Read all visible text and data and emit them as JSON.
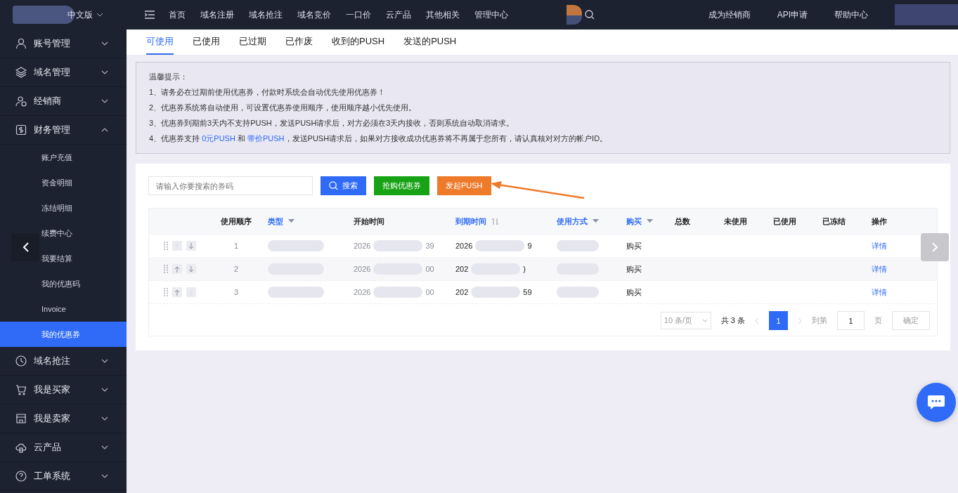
{
  "topbar": {
    "language": "中文版",
    "nav": [
      "首页",
      "域名注册",
      "域名抢注",
      "域名竞价",
      "一口价",
      "云产品",
      "其他相关",
      "管理中心"
    ],
    "right_links": [
      "成为经销商",
      "API申请",
      "帮助中心"
    ]
  },
  "sidebar": {
    "items": [
      {
        "label": "账号管理",
        "kind": "user",
        "expanded": false
      },
      {
        "label": "域名管理",
        "kind": "layers",
        "expanded": false
      },
      {
        "label": "经销商",
        "kind": "dealer",
        "expanded": false
      },
      {
        "label": "财务管理",
        "kind": "wallet",
        "expanded": true,
        "children": [
          {
            "label": "账户充值",
            "selected": false
          },
          {
            "label": "资金明细",
            "selected": false
          },
          {
            "label": "冻结明细",
            "selected": false
          },
          {
            "label": "续费中心",
            "selected": false
          },
          {
            "label": "我要结算",
            "selected": false
          },
          {
            "label": "我的优惠码",
            "selected": false
          },
          {
            "label": "Invoice",
            "selected": false
          },
          {
            "label": "我的优惠券",
            "selected": true
          }
        ]
      },
      {
        "label": "域名抢注",
        "kind": "clock",
        "expanded": false
      },
      {
        "label": "我是买家",
        "kind": "cart",
        "expanded": false
      },
      {
        "label": "我是卖家",
        "kind": "store",
        "expanded": false
      },
      {
        "label": "云产品",
        "kind": "cloud",
        "expanded": false
      },
      {
        "label": "工单系统",
        "kind": "help",
        "expanded": false
      }
    ]
  },
  "tabs": [
    {
      "label": "可使用",
      "selected": true
    },
    {
      "label": "已使用",
      "selected": false
    },
    {
      "label": "已过期",
      "selected": false
    },
    {
      "label": "已作废",
      "selected": false
    },
    {
      "label": "收到的PUSH",
      "selected": false
    },
    {
      "label": "发送的PUSH",
      "selected": false
    }
  ],
  "notice": {
    "title": "温馨提示：",
    "lines": [
      "1、请务必在过期前使用优惠券，付款时系统会自动优先使用优惠券！",
      "2、优惠券系统将自动使用，可设置优惠券使用顺序，使用顺序越小优先使用。",
      "3、优惠券到期前3天内不支持PUSH，发送PUSH请求后，对方必须在3天内接收，否则系统自动取消请求。"
    ],
    "last_line": {
      "prefix": "4、优惠券支持 ",
      "link1": "0元PUSH",
      "middle": " 和 ",
      "link2": "带价PUSH",
      "suffix": "，发送PUSH请求后，如果对方接收成功优惠券将不再属于您所有，请认真核对对方的帐户ID。"
    }
  },
  "search": {
    "placeholder": "请输入你要搜索的券码",
    "button": "搜索"
  },
  "buttons": [
    {
      "label": "抢购优惠券",
      "kind": "buy"
    },
    {
      "label": "发起PUSH",
      "kind": "push"
    }
  ],
  "table": {
    "columns": [
      {
        "label": "使用顺序",
        "kind": "plain"
      },
      {
        "label": "类型",
        "kind": "filter"
      },
      {
        "label": "开始时间",
        "kind": "plain"
      },
      {
        "label": "到期时间",
        "kind": "sort"
      },
      {
        "label": "使用方式",
        "kind": "filter"
      },
      {
        "label": "购买",
        "kind": "filter"
      },
      {
        "label": "总数",
        "kind": "plain"
      },
      {
        "label": "未使用",
        "kind": "plain"
      },
      {
        "label": "已使用",
        "kind": "plain"
      },
      {
        "label": "已冻结",
        "kind": "plain"
      },
      {
        "label": "操作",
        "kind": "plain"
      }
    ],
    "rows": [
      {
        "order": "1",
        "up_disabled": true,
        "down_disabled": false,
        "start": {
          "head": "2026",
          "tail": "39"
        },
        "end": {
          "head": "2026",
          "tail": "9"
        },
        "buy": "购买",
        "action": "详情"
      },
      {
        "order": "2",
        "up_disabled": false,
        "down_disabled": false,
        "start": {
          "head": "2026",
          "tail": "00"
        },
        "end": {
          "head": "202",
          "tail": ")"
        },
        "buy": "购买",
        "action": "详情"
      },
      {
        "order": "3",
        "up_disabled": false,
        "down_disabled": true,
        "start": {
          "head": "2026",
          "tail": "00"
        },
        "end": {
          "head": "202",
          "tail": "59"
        },
        "buy": "购买",
        "action": "详情"
      }
    ]
  },
  "pagination": {
    "page_size": "10 条/页",
    "total": "共 3 条",
    "pages": [
      {
        "label": "1",
        "selected": true
      }
    ],
    "goto_label": "到第",
    "goto_value": "1",
    "page_unit": "页",
    "confirm": "确定"
  }
}
